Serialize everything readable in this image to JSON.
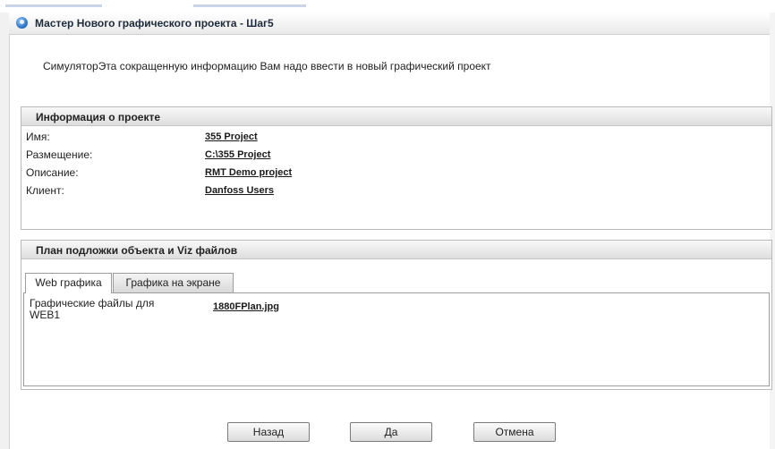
{
  "window": {
    "title": "Мастер Нового графического проекта - Шаг5",
    "icon": "info-icon"
  },
  "intro_text": "СимуляторЭта сокращенную информацию Вам надо ввести в новый графический проект",
  "project_info": {
    "header": "Информация о проекте",
    "rows": [
      {
        "label": "Имя:",
        "value": "355 Project"
      },
      {
        "label": "Размещение:",
        "value": "C:\\355 Project"
      },
      {
        "label": "Описание:",
        "value": "RMT Demo project"
      },
      {
        "label": "Клиент:",
        "value": "Danfoss Users"
      }
    ]
  },
  "floorplan": {
    "header": "План подложки объекта и Viz файлов",
    "tabs": [
      {
        "label": "Web графика",
        "active": true
      },
      {
        "label": "Графика на экране",
        "active": false
      }
    ],
    "file_label": "Графические файлы для WEB1",
    "file_value": "1880FPlan.jpg"
  },
  "buttons": {
    "back": "Назад",
    "yes": "Да",
    "cancel": "Отмена"
  }
}
